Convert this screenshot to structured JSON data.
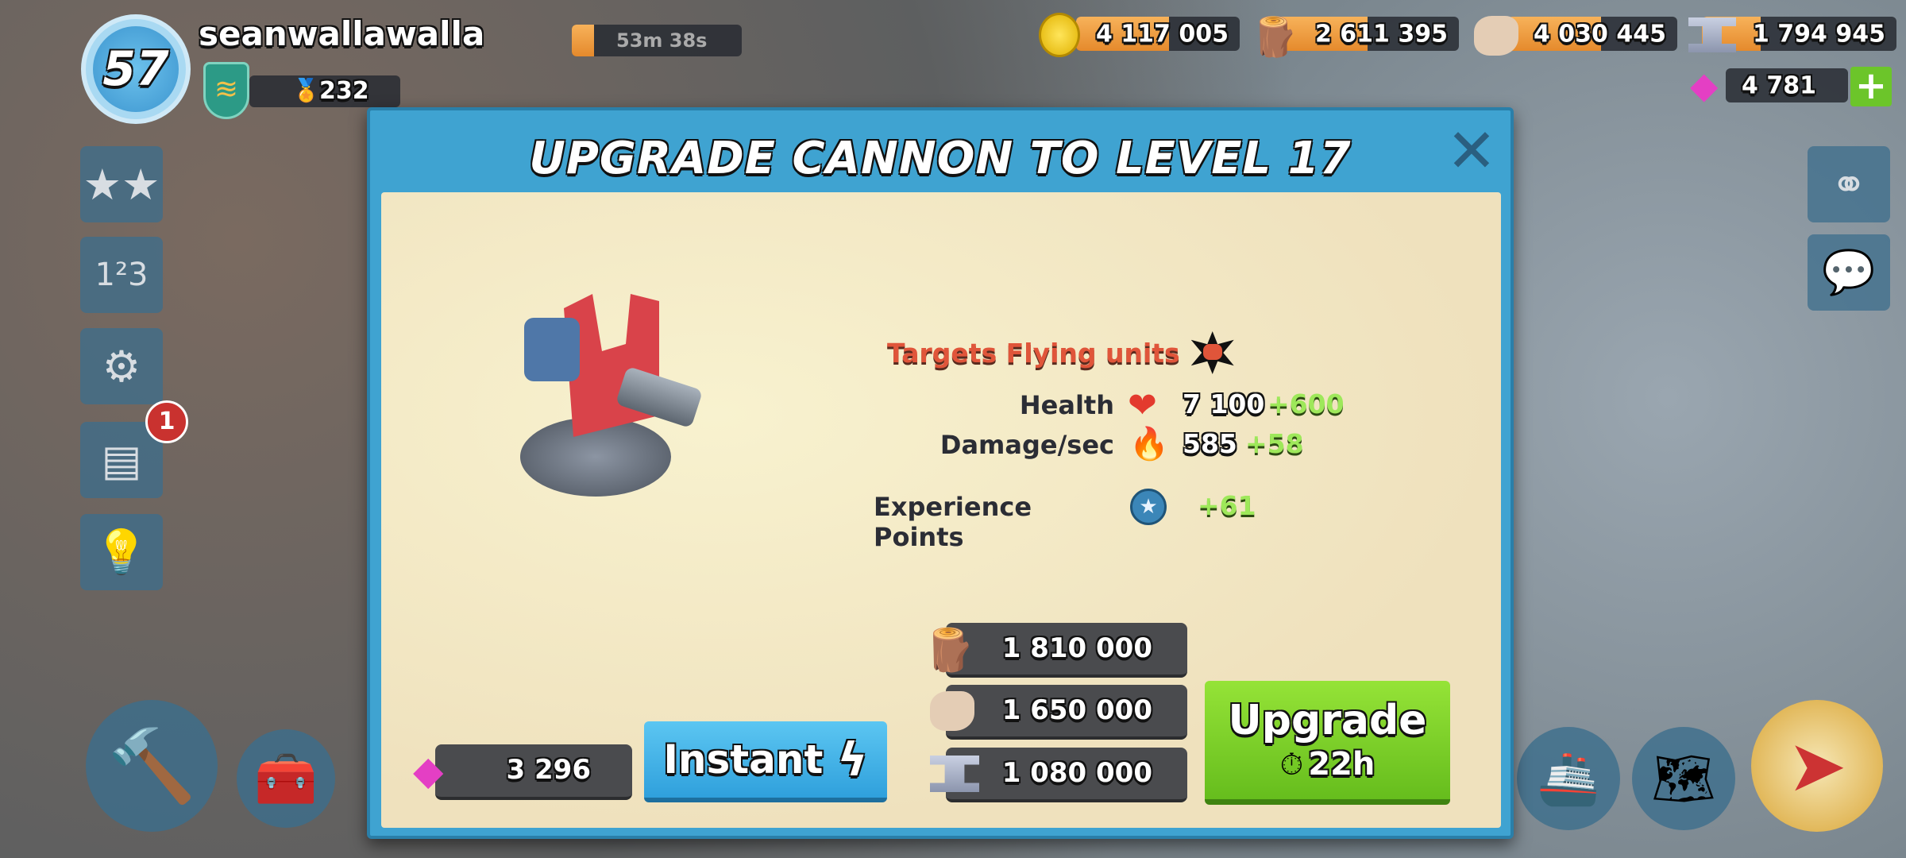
{
  "player": {
    "level": "57",
    "name": "seanwallawalla",
    "medals": "232",
    "timer": "53m 38s"
  },
  "resources": {
    "gold": "4 117 005",
    "wood": "2 611 395",
    "stone": "4 030 445",
    "iron": "1 794 945",
    "gems": "4 781",
    "gold_fill": 0.57,
    "wood_fill": 0.5,
    "stone_fill": 0.55,
    "iron_fill": 0.3
  },
  "sidebar": {
    "notification_count": "1"
  },
  "dialog": {
    "title": "UPGRADE CANNON TO LEVEL 17",
    "targets": "Targets Flying units",
    "stats": [
      {
        "label": "Health",
        "value": "7 100",
        "bonus": "+600"
      },
      {
        "label": "Damage/sec",
        "value": "585",
        "bonus": "+58"
      },
      {
        "label": "Experience Points",
        "value": "",
        "bonus": "+61"
      }
    ],
    "costs": {
      "wood": "1 810 000",
      "stone": "1 650 000",
      "iron": "1 080 000"
    },
    "instant_cost": "3 296",
    "instant_label": "Instant",
    "upgrade_label": "Upgrade",
    "upgrade_time": "22h"
  },
  "colors": {
    "frame": "#3fa3d1",
    "parchment": "#f2e6c3",
    "upgrade_green": "#7dd321",
    "instant_blue": "#3fb2ea",
    "bonus_green": "#9ee85a",
    "targets_red": "#e0553a"
  }
}
